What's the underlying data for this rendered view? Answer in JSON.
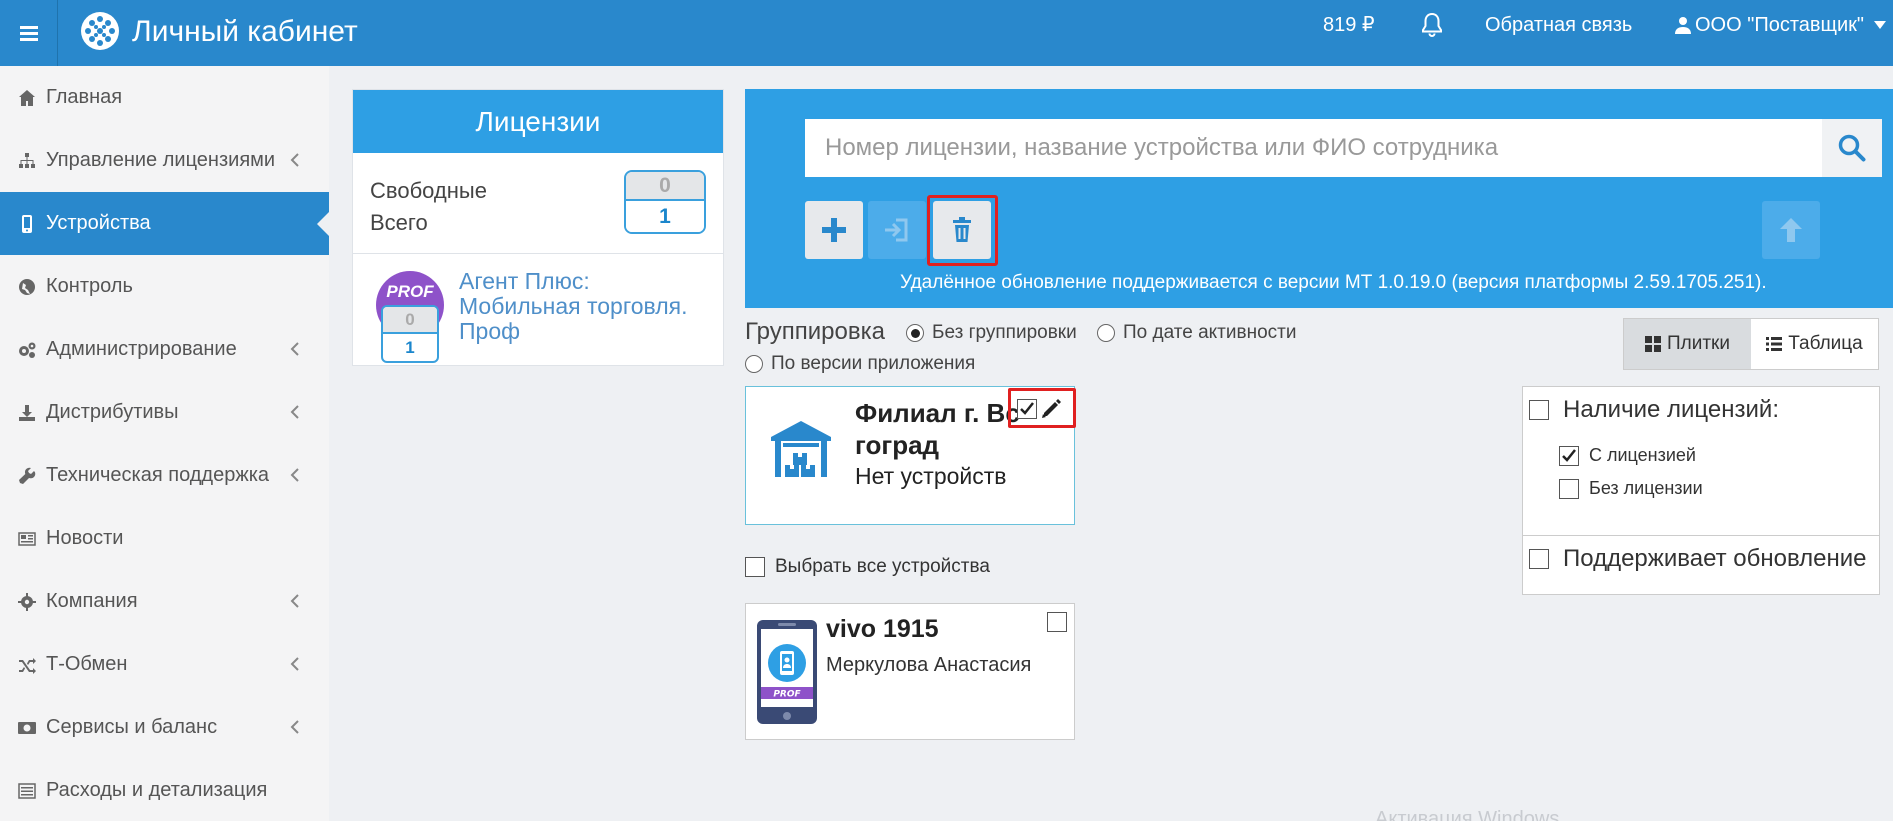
{
  "header": {
    "app_title": "Личный кабинет",
    "balance": "819 ₽",
    "feedback": "Обратная связь",
    "user": "ООО \"Поставщик\""
  },
  "sidebar": {
    "items": [
      {
        "label": "Главная",
        "icon": "home-icon",
        "has_chevron": false
      },
      {
        "label": "Управление лицензиями",
        "icon": "sitemap-icon",
        "has_chevron": true
      },
      {
        "label": "Устройства",
        "icon": "mobile-icon",
        "has_chevron": false,
        "active": true
      },
      {
        "label": "Контроль",
        "icon": "globe-icon",
        "has_chevron": false
      },
      {
        "label": "Администрирование",
        "icon": "gears-icon",
        "has_chevron": true
      },
      {
        "label": "Дистрибутивы",
        "icon": "download-icon",
        "has_chevron": true
      },
      {
        "label": "Техническая поддержка",
        "icon": "wrench-icon",
        "has_chevron": true
      },
      {
        "label": "Новости",
        "icon": "newspaper-icon",
        "has_chevron": false
      },
      {
        "label": "Компания",
        "icon": "gear-icon",
        "has_chevron": true
      },
      {
        "label": "Т-Обмен",
        "icon": "random-icon",
        "has_chevron": true
      },
      {
        "label": "Сервисы и баланс",
        "icon": "money-icon",
        "has_chevron": true
      },
      {
        "label": "Расходы и детализация",
        "icon": "list-icon",
        "has_chevron": false
      }
    ]
  },
  "licenses": {
    "title": "Лицензии",
    "free_label": "Свободные",
    "total_label": "Всего",
    "free_count": "0",
    "total_count": "1",
    "product": {
      "badge": "PROF",
      "name": "Агент Плюс: Мобильная торговля. Проф",
      "free_count": "0",
      "total_count": "1"
    }
  },
  "search": {
    "placeholder": "Номер лицензии, название устройства или ФИО сотрудника",
    "update_note": "Удалённое обновление поддерживается с версии МТ 1.0.19.0 (версия платформы 2.59.1705.251)."
  },
  "grouping": {
    "label": "Группировка",
    "options": [
      "Без группировки",
      "По дате активности",
      "По версии приложения"
    ],
    "selected": "Без группировки"
  },
  "view": {
    "tiles": "Плитки",
    "table": "Таблица",
    "selected": "Плитки"
  },
  "branch": {
    "name": "Филиал г. Вс гоград",
    "subtitle": "Нет устройств",
    "checked": true
  },
  "select_all": "Выбрать все устройства",
  "device": {
    "name": "vivo 1915",
    "user": "Меркулова Анастасия",
    "badge": "PROF"
  },
  "filters": {
    "licenses_title": "Наличие лицензий:",
    "with_license": "С лицензией",
    "without_license": "Без лицензии",
    "supports_update": "Поддерживает обновление",
    "with_license_checked": true
  },
  "watermark": "Активация Windows",
  "colors": {
    "primary": "#2988cc",
    "panel": "#2e9fe4",
    "highlight": "#e02020",
    "prof": "#8e52c9"
  }
}
